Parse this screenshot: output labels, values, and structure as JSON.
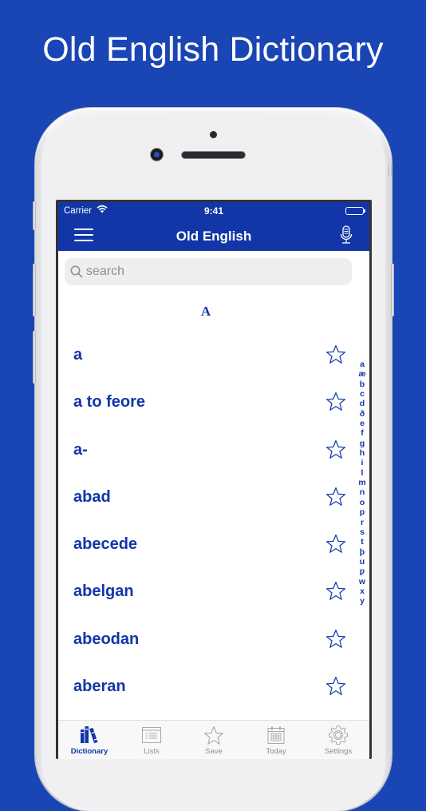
{
  "promo": {
    "title": "Old English Dictionary"
  },
  "status_bar": {
    "carrier": "Carrier",
    "time": "9:41"
  },
  "nav": {
    "title": "Old English",
    "menu_icon": "hamburger-menu-icon",
    "mic_icon": "microphone-icon"
  },
  "search": {
    "placeholder": "search",
    "value": ""
  },
  "list": {
    "section_header": "A",
    "words": [
      {
        "label": "a",
        "favorited": false
      },
      {
        "label": "a to feore",
        "favorited": false
      },
      {
        "label": "a-",
        "favorited": false
      },
      {
        "label": "abad",
        "favorited": false
      },
      {
        "label": "abecede",
        "favorited": false
      },
      {
        "label": "abelgan",
        "favorited": false
      },
      {
        "label": "abeodan",
        "favorited": false
      },
      {
        "label": "aberan",
        "favorited": false
      }
    ]
  },
  "index": [
    "a",
    "æ",
    "b",
    "c",
    "d",
    "ð",
    "e",
    "f",
    "g",
    "h",
    "i",
    "l",
    "m",
    "n",
    "o",
    "p",
    "r",
    "s",
    "t",
    "þ",
    "u",
    "ƿ",
    "w",
    "x",
    "y"
  ],
  "tabs": [
    {
      "label": "Dictionary",
      "icon": "books-icon",
      "active": true
    },
    {
      "label": "Lists",
      "icon": "list-icon",
      "active": false
    },
    {
      "label": "Save",
      "icon": "star-icon",
      "active": false
    },
    {
      "label": "Today",
      "icon": "calendar-icon",
      "active": false
    },
    {
      "label": "Settings",
      "icon": "gear-icon",
      "active": false
    }
  ],
  "colors": {
    "background": "#1a45b5",
    "accent": "#1236a8",
    "tab_inactive": "#8e8e93"
  }
}
